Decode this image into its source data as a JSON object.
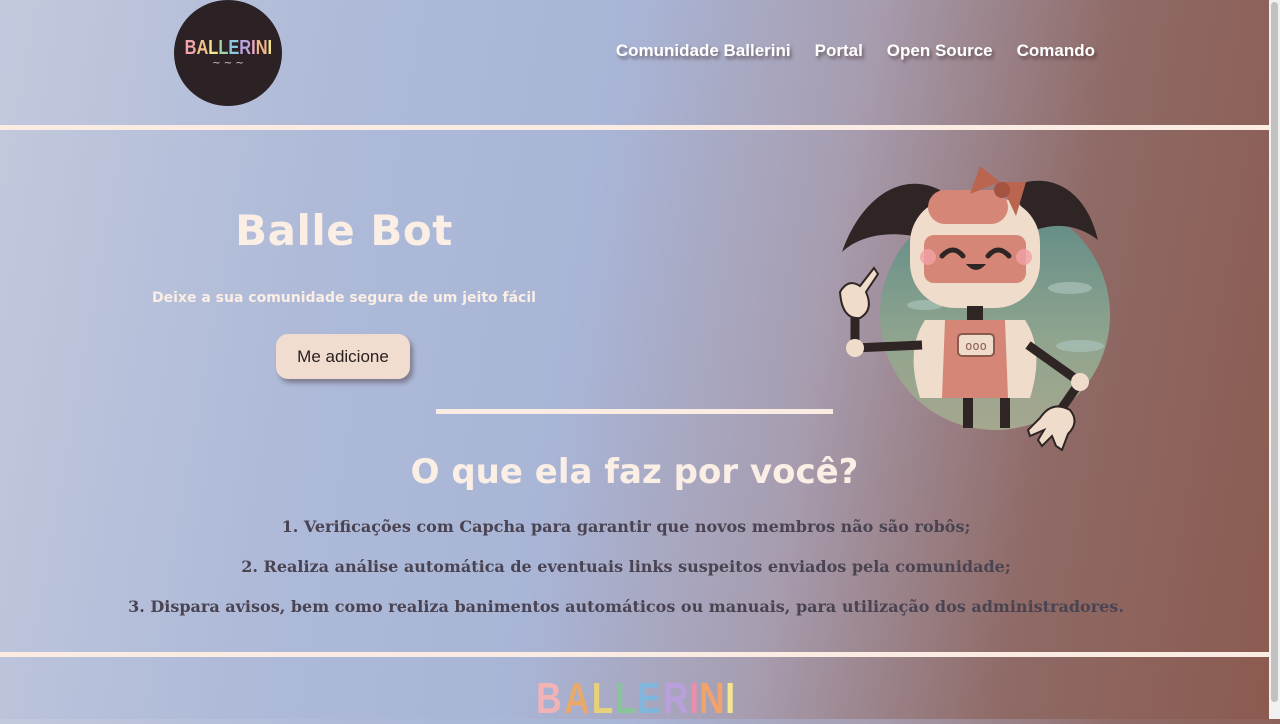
{
  "header": {
    "logo_text": [
      "B",
      "A",
      "L",
      "L",
      "E",
      "R",
      "I",
      "N",
      "I"
    ],
    "logo_colors": [
      "#f0a6a8",
      "#f2c28b",
      "#f4e68c",
      "#9fd6a4",
      "#8fc6e0",
      "#b9a4de",
      "#f0a6c2",
      "#f2b48b",
      "#f4e68c"
    ],
    "logo_squiggle": "~ ~ ~",
    "nav": [
      "Comunidade Ballerini",
      "Portal",
      "Open Source",
      "Comando"
    ]
  },
  "hero": {
    "title": "Balle Bot",
    "subtitle": "Deixe a sua comunidade segura de um jeito fácil",
    "add_button": "Me adicione",
    "robot_screen_text": "ooo"
  },
  "features": {
    "title": "O que ela faz por você?",
    "items": [
      "1. Verificações com Capcha para garantir que novos membros não são robôs;",
      "2. Realiza análise automática de eventuais links suspeitos enviados pela comunidade;",
      "3. Dispara avisos, bem como realiza banimentos automáticos ou manuais, para utilização dos administradores."
    ]
  },
  "footer": {
    "logo_text": [
      "B",
      "A",
      "L",
      "L",
      "E",
      "R",
      "I",
      "N",
      "I"
    ],
    "logo_colors": [
      "#f2b3b6",
      "#e8a96b",
      "#e7d27a",
      "#88c69a",
      "#7fb7dc",
      "#b9a0dd",
      "#e98fae",
      "#f0a36b",
      "#f4e68c"
    ]
  },
  "colors": {
    "accent_cream": "#fbece3",
    "button_bg": "#f1ddd0",
    "robot_pink": "#d58676",
    "robot_hair": "#2f2525"
  }
}
